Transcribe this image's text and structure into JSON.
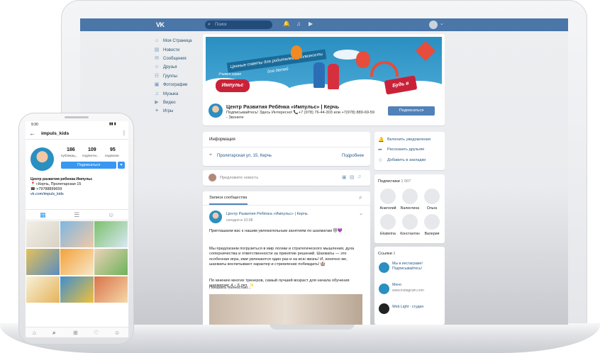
{
  "vk": {
    "logo": "VK",
    "search": {
      "placeholder": "Поиск"
    },
    "sidebar": [
      {
        "label": "Моя Страница",
        "icon": "home-icon"
      },
      {
        "label": "Новости",
        "icon": "news-icon"
      },
      {
        "label": "Сообщения",
        "icon": "messages-icon"
      },
      {
        "label": "Друзья",
        "icon": "friends-icon"
      },
      {
        "label": "Группы",
        "icon": "groups-icon"
      },
      {
        "label": "Фотографии",
        "icon": "photos-icon"
      },
      {
        "label": "Музыка",
        "icon": "music-icon"
      },
      {
        "label": "Видео",
        "icon": "video-icon"
      },
      {
        "label": "Игры",
        "icon": "games-icon"
      }
    ],
    "cover": {
      "ribbon": "Ценные советы для родителей и полезности для детей",
      "logo_small": "Учимся играя",
      "logo_text": "Импульс",
      "join_badge": "Будь в курсе"
    },
    "group": {
      "name": "Центр Развития Ребёнка «Импульс» | Керчь",
      "status": "Подписывайтесь! Здесь Интересно! 📞+7 (978) 76-44-303 или +7(978) 889-69-59 - Звоните",
      "subscribe_button": "Подписаться"
    },
    "info": {
      "title": "Информация",
      "address": "Пролетарская ул, 15, Керчь",
      "more": "Подробнее"
    },
    "actions": [
      {
        "label": "Включить уведомления",
        "icon": "bell-icon"
      },
      {
        "label": "Рассказать друзьям",
        "icon": "share-icon"
      },
      {
        "label": "Добавить в закладки",
        "icon": "star-icon"
      }
    ],
    "suggest": {
      "placeholder": "Предложите новость"
    },
    "subscribers": {
      "title": "Подписчики",
      "count": "1 007",
      "names": [
        "Анатолий",
        "Валентина",
        "Ольга",
        "Ekaterina",
        "Константин",
        "Валерия"
      ]
    },
    "wall": {
      "tab": "Записи сообщества",
      "post": {
        "author": "Центр Развития Ребёнка «Импульс» | Керчь",
        "time": "сегодня в 10:08",
        "p1": "Приглашаем вас к нашим увлекательным занятиям по шахматам 😻💜",
        "p2": "Мы предлагаем погрузиться в мир логики и стратегического мышления, духа соперничества и ответственности за принятие решений. Шахматы — это особенная игра, ими увлекаются один раз и на всю жизнь! И, конечно же, шахматы воспитывают характер и стремление побеждать! 🏰",
        "p3": "По мнению многих тренеров, самый лучший возраст для начала обучения шахматам: 4 – 6 лет. ✨",
        "more": "Показать полностью..."
      }
    },
    "links": {
      "title": "Ссылки",
      "count": "3",
      "items": [
        {
          "title": "Мы в инстаграме! Подписывайтесь!",
          "sub": ""
        },
        {
          "title": "Мено",
          "sub": "www.instagram.com"
        },
        {
          "title": "Web Light - студия",
          "sub": ""
        }
      ]
    }
  },
  "insta": {
    "time": "9:30",
    "username": "impuls_kids",
    "stats": [
      {
        "value": "186",
        "label": "публикац..."
      },
      {
        "value": "109",
        "label": "подписчи..."
      },
      {
        "value": "95",
        "label": "подписки"
      }
    ],
    "subscribe_button": "Подписаться",
    "bio": {
      "name": "Центр развития ребенка Импульс",
      "line1": "📍 г.Керчь, Пролетарская 15",
      "line2": "☎ +79788899659",
      "link": "vk.com/impuls_kids"
    }
  },
  "colors": {
    "vk_blue": "#4a76a8",
    "vk_button": "#5181b8",
    "cover_red": "#c92238"
  }
}
